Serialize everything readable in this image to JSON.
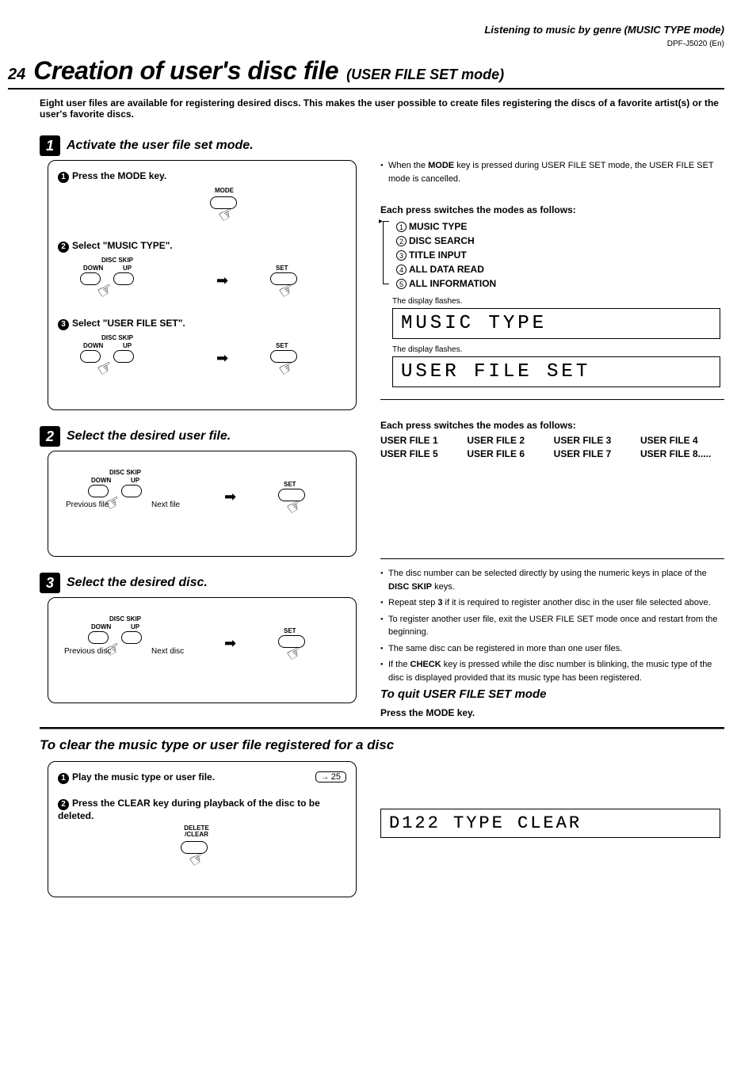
{
  "header": {
    "section_title": "Listening to music by genre (MUSIC TYPE mode)",
    "model": "DPF-J5020 (En)"
  },
  "page": {
    "number": "24",
    "title": "Creation of user's disc file",
    "subtitle": "(USER FILE SET mode)",
    "intro": "Eight user files are available for registering desired discs. This makes the user possible to create files registering the discs of a favorite artist(s) or the user's favorite discs."
  },
  "step1": {
    "num": "1",
    "title": "Activate the user file set mode.",
    "sub1": "Press the MODE key.",
    "sub1_label": "MODE",
    "sub2": "Select \"MUSIC TYPE\".",
    "sub3": "Select \"USER FILE SET\".",
    "disc_skip": "DISC SKIP",
    "down": "DOWN",
    "up": "UP",
    "set": "SET",
    "note1": "When the ",
    "note1_bold": "MODE",
    "note1_rest": " key is pressed during USER FILE SET mode, the USER FILE SET mode is cancelled.",
    "each_press": "Each press switches the modes as follows:",
    "modes": [
      "MUSIC TYPE",
      "DISC SEARCH",
      "TITLE INPUT",
      "ALL DATA READ",
      "ALL INFORMATION"
    ],
    "display_flashes": "The display flashes.",
    "display1": "MUSIC TYPE",
    "display2": "USER FILE SET"
  },
  "step2": {
    "num": "2",
    "title": "Select the desired user file.",
    "disc_skip": "DISC SKIP",
    "down": "DOWN",
    "up": "UP",
    "set": "SET",
    "prev": "Previous file",
    "next": "Next file",
    "each_press": "Each press switches the modes as follows:",
    "files": [
      "USER FILE 1",
      "USER FILE 2",
      "USER FILE 3",
      "USER FILE 4",
      "USER FILE 5",
      "USER FILE 6",
      "USER FILE 7",
      "USER FILE 8....."
    ]
  },
  "step3": {
    "num": "3",
    "title": "Select the desired disc.",
    "disc_skip": "DISC SKIP",
    "down": "DOWN",
    "up": "UP",
    "set": "SET",
    "prev": "Previous disc",
    "next": "Next disc",
    "notes": [
      {
        "pre": "The disc number can be selected directly by using the numeric keys in place of the ",
        "bold": "DISC SKIP",
        "post": " keys."
      },
      {
        "pre": "Repeat step ",
        "bold": "3",
        "post": " if it is required to register another disc in the user file selected above."
      },
      {
        "pre": "To register another user file, exit the USER FILE SET mode once and restart from the beginning.",
        "bold": "",
        "post": ""
      },
      {
        "pre": "The same disc can be registered in more than one user files.",
        "bold": "",
        "post": ""
      },
      {
        "pre": "If the ",
        "bold": "CHECK",
        "post": " key is pressed while the disc number is blinking, the music type of the disc is displayed provided that its music type has been registered."
      }
    ],
    "quit_title": "To quit USER FILE SET mode",
    "quit_text": "Press the MODE key."
  },
  "clear": {
    "title": "To clear the music type or user file registered for a disc",
    "sub1": "Play the music type or user file.",
    "sub1_ref": "25",
    "sub2": "Press the CLEAR key during playback of the disc to be deleted.",
    "btn_label": "DELETE /CLEAR",
    "display": "D122 TYPE CLEAR"
  }
}
